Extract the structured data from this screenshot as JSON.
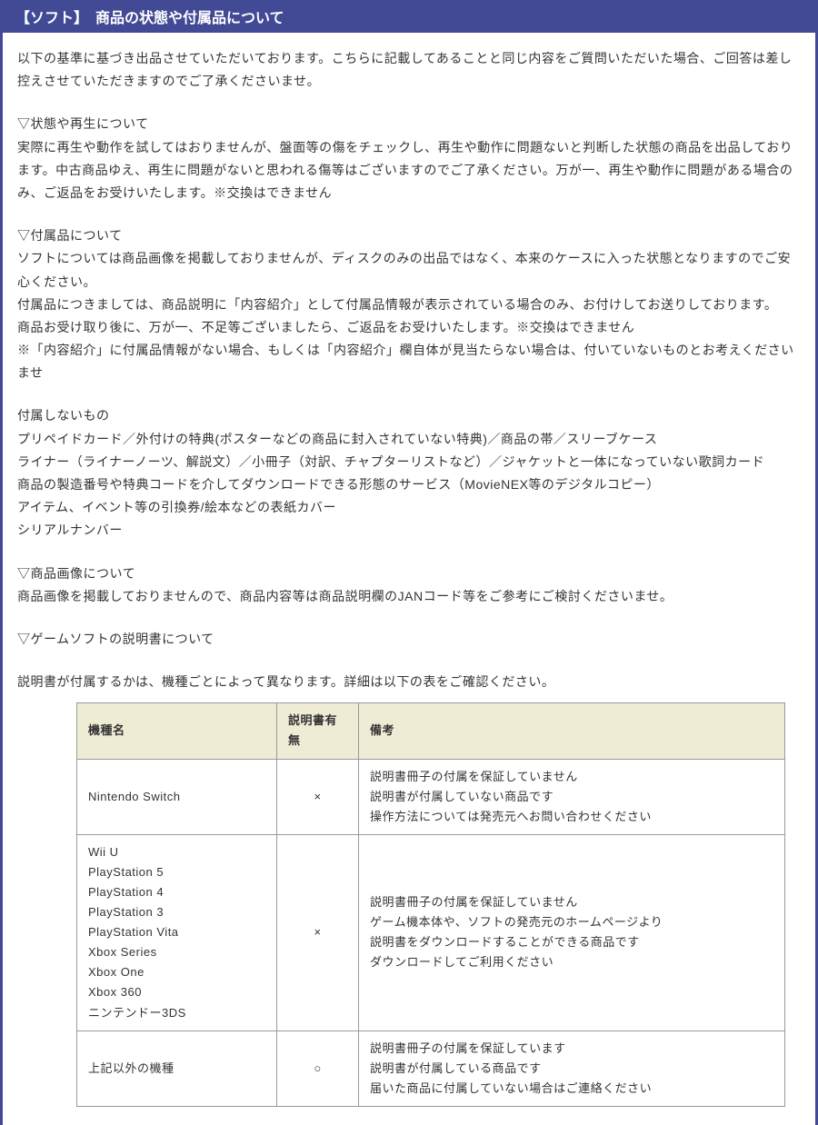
{
  "header": {
    "title": "【ソフト】　商品の状態や付属品について"
  },
  "intro": {
    "p1": "以下の基準に基づき出品させていただいております。こちらに記載してあることと同じ内容をご質問いただいた場合、ご回答は差し控えさせていただきますのでご了承くださいませ。"
  },
  "condition": {
    "heading": "▽状態や再生について",
    "p1": "実際に再生や動作を試してはおりませんが、盤面等の傷をチェックし、再生や動作に問題ないと判断した状態の商品を出品しております。中古商品ゆえ、再生に問題がないと思われる傷等はございますのでご了承ください。万が一、再生や動作に問題がある場合のみ、ご返品をお受けいたします。※交換はできません"
  },
  "accessory": {
    "heading": "▽付属品について",
    "p1": "ソフトについては商品画像を掲載しておりませんが、ディスクのみの出品ではなく、本来のケースに入った状態となりますのでご安心ください。",
    "p2": "付属品につきましては、商品説明に「内容紹介」として付属品情報が表示されている場合のみ、お付けしてお送りしております。",
    "p3": "商品お受け取り後に、万が一、不足等ございましたら、ご返品をお受けいたします。※交換はできません",
    "p4": "※「内容紹介」に付属品情報がない場合、もしくは「内容紹介」欄自体が見当たらない場合は、付いていないものとお考えくださいませ"
  },
  "excluded": {
    "heading": "付属しないもの",
    "p1": "プリペイドカード／外付けの特典(ポスターなどの商品に封入されていない特典)／商品の帯／スリーブケース",
    "p2": "ライナー（ライナーノーツ、解説文）／小冊子（対訳、チャプターリストなど）／ジャケットと一体になっていない歌詞カード",
    "p3": "商品の製造番号や特典コードを介してダウンロードできる形態のサービス（MovieNEX等のデジタルコピー）",
    "p4": "アイテム、イベント等の引換券/絵本などの表紙カバー",
    "p5": "シリアルナンバー"
  },
  "image": {
    "heading": "▽商品画像について",
    "p1": "商品画像を掲載しておりませんので、商品内容等は商品説明欄のJANコード等をご参考にご検討くださいませ。"
  },
  "manual": {
    "heading": "▽ゲームソフトの説明書について",
    "p1": "説明書が付属するかは、機種ごとによって異なります。詳細は以下の表をご確認ください。",
    "th1": "機種名",
    "th2": "説明書有無",
    "th3": "備考",
    "rows": [
      {
        "model": "Nintendo Switch",
        "has": "×",
        "note": "説明書冊子の付属を保証していません\n説明書が付属していない商品です\n操作方法については発売元へお問い合わせください"
      },
      {
        "model": "Wii U\nPlayStation 5\nPlayStation 4\nPlayStation 3\nPlayStation Vita\nXbox Series\nXbox One\nXbox 360\nニンテンドー3DS",
        "has": "×",
        "note": "説明書冊子の付属を保証していません\nゲーム機本体や、ソフトの発売元のホームページより\n説明書をダウンロードすることができる商品です\nダウンロードしてご利用ください"
      },
      {
        "model": "上記以外の機種",
        "has": "○",
        "note": "説明書冊子の付属を保証しています\n説明書が付属している商品です\n届いた商品に付属していない場合はご連絡ください"
      }
    ]
  }
}
